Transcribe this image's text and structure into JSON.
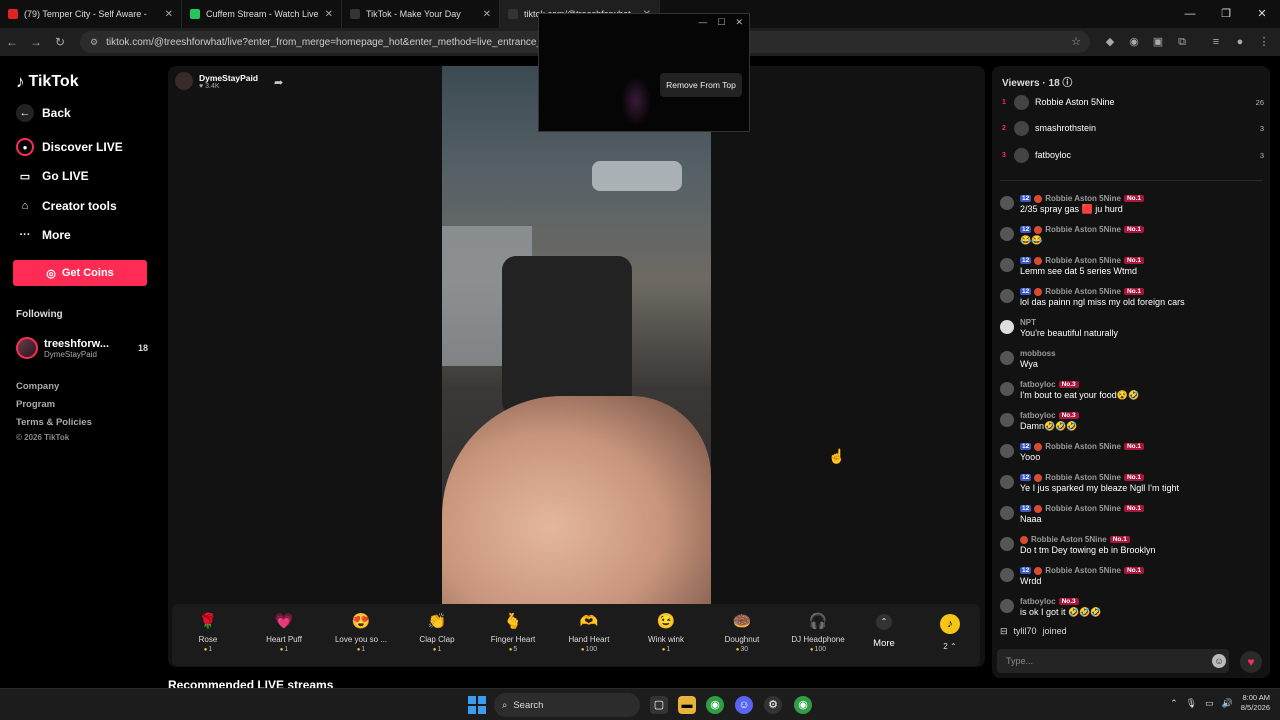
{
  "browser": {
    "tabs": [
      {
        "title": "(79) Temper City - Self Aware -",
        "favicon_color": "#e02424"
      },
      {
        "title": "Cuffem Stream - Watch Live",
        "favicon_color": "#22c55e"
      },
      {
        "title": "TikTok - Make Your Day",
        "favicon_color": "#111111"
      },
      {
        "title": "tiktok.com/@treeshforwhat",
        "favicon_color": "#111111"
      }
    ],
    "url": "tiktok.com/@treeshforwhat/live?enter_from_merge=homepage_hot&enter_method=live_entrance_hover_"
  },
  "popup": {
    "remove_label": "Remove From Top"
  },
  "sidebar": {
    "logo": "TikTok",
    "back": "Back",
    "nav": [
      {
        "label": "Discover LIVE",
        "icon": "discover-live-icon"
      },
      {
        "label": "Go LIVE",
        "icon": "go-live-icon"
      },
      {
        "label": "Creator tools",
        "icon": "creator-tools-icon"
      },
      {
        "label": "More",
        "icon": "more-icon"
      }
    ],
    "get_coins": "Get Coins",
    "following_label": "Following",
    "following": [
      {
        "name": "treeshforw...",
        "sub": "DymeStayPaid",
        "count": "18"
      }
    ],
    "footer": [
      "Company",
      "Program",
      "Terms & Policies"
    ],
    "copyright": "© 2026 TikTok"
  },
  "stream": {
    "host_name": "DymeStayPaid",
    "host_likes": "3.4K"
  },
  "gifts": [
    {
      "name": "Rose",
      "price": "1",
      "icon": "🌹"
    },
    {
      "name": "Heart Puff",
      "price": "1",
      "icon": "💗"
    },
    {
      "name": "Love you so ...",
      "price": "1",
      "icon": "😍"
    },
    {
      "name": "Clap Clap",
      "price": "1",
      "icon": "👏"
    },
    {
      "name": "Finger Heart",
      "price": "5",
      "icon": "🫰"
    },
    {
      "name": "Hand Heart",
      "price": "100",
      "icon": "🫶"
    },
    {
      "name": "Wink wink",
      "price": "1",
      "icon": "😉"
    },
    {
      "name": "Doughnut",
      "price": "30",
      "icon": "🍩"
    },
    {
      "name": "DJ Headphone",
      "price": "100",
      "icon": "🎧"
    }
  ],
  "gift_more": "More",
  "coin_balance": "2",
  "recommended_label": "Recommended LIVE streams",
  "viewers": {
    "title": "Viewers · 18",
    "top": [
      {
        "rank": "1",
        "name": "Robbie Aston 5Nine",
        "score": "26"
      },
      {
        "rank": "2",
        "name": "smashrothstein",
        "score": "3"
      },
      {
        "rank": "3",
        "name": "fatboyloc",
        "score": "3"
      }
    ]
  },
  "chat": [
    {
      "user": "Robbie Aston 5Nine",
      "level": "12",
      "badge": "No.1",
      "text": "2/35 spray gas 🟥 ju hurd"
    },
    {
      "user": "Robbie Aston 5Nine",
      "level": "12",
      "badge": "No.1",
      "text": "😂😂"
    },
    {
      "user": "Robbie Aston 5Nine",
      "level": "12",
      "badge": "No.1",
      "text": "Lemm see dat 5 series Wtmd"
    },
    {
      "user": "Robbie Aston 5Nine",
      "level": "12",
      "badge": "No.1",
      "text": "lol das painn ngl miss my old foreign cars"
    },
    {
      "user": "NPT",
      "level": "",
      "badge": "",
      "text": "You're beautiful naturally"
    },
    {
      "user": "mobboss",
      "level": "",
      "badge": "",
      "text": "Wya"
    },
    {
      "user": "fatboyloc",
      "level": "",
      "badge": "No.3",
      "text": "I'm bout to eat your food😵🤣"
    },
    {
      "user": "fatboyloc",
      "level": "",
      "badge": "No.3",
      "text": "Damn🤣🤣🤣"
    },
    {
      "user": "Robbie Aston 5Nine",
      "level": "12",
      "badge": "No.1",
      "text": "Yooo"
    },
    {
      "user": "Robbie Aston 5Nine",
      "level": "12",
      "badge": "No.1",
      "text": "Ye I jus sparked my bleaze Ngll I'm tight"
    },
    {
      "user": "Robbie Aston 5Nine",
      "level": "12",
      "badge": "No.1",
      "text": "Naaa"
    },
    {
      "user": "Robbie Aston 5Nine",
      "level": "",
      "badge": "No.1",
      "text": "Do t tm Dey towing eb in Brooklyn"
    },
    {
      "user": "Robbie Aston 5Nine",
      "level": "12",
      "badge": "No.1",
      "text": "Wrdd"
    },
    {
      "user": "fatboyloc",
      "level": "",
      "badge": "No.3",
      "text": "is ok I got it 🤣🤣🤣"
    }
  ],
  "joined": {
    "user": "tylil70",
    "text": "joined"
  },
  "chat_input_placeholder": "Type...",
  "taskbar": {
    "search_label": "Search",
    "time": "8:00 AM",
    "date": "8/5/2026"
  },
  "colors": {
    "accent": "#fe2c55",
    "level_badge": "#3a59c7",
    "rank_badge": "#a9163b",
    "coin": "#f5c518"
  }
}
